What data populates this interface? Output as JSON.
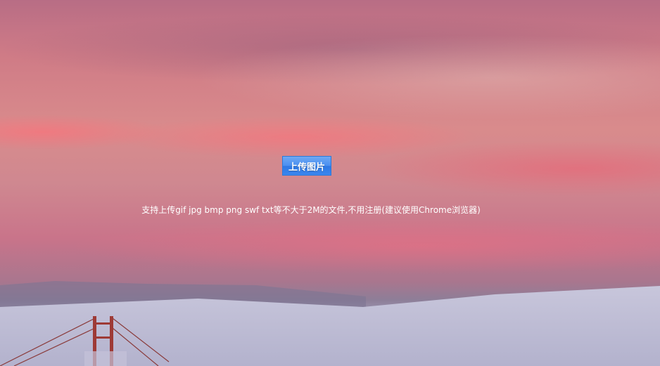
{
  "upload": {
    "button_label": "上传图片"
  },
  "hint": {
    "text": "支持上传gif jpg bmp png swf txt等不大于2M的文件,不用注册(建议使用Chrome浏览器)"
  },
  "colors": {
    "button": "#3a86ee",
    "text": "#ffffff"
  }
}
